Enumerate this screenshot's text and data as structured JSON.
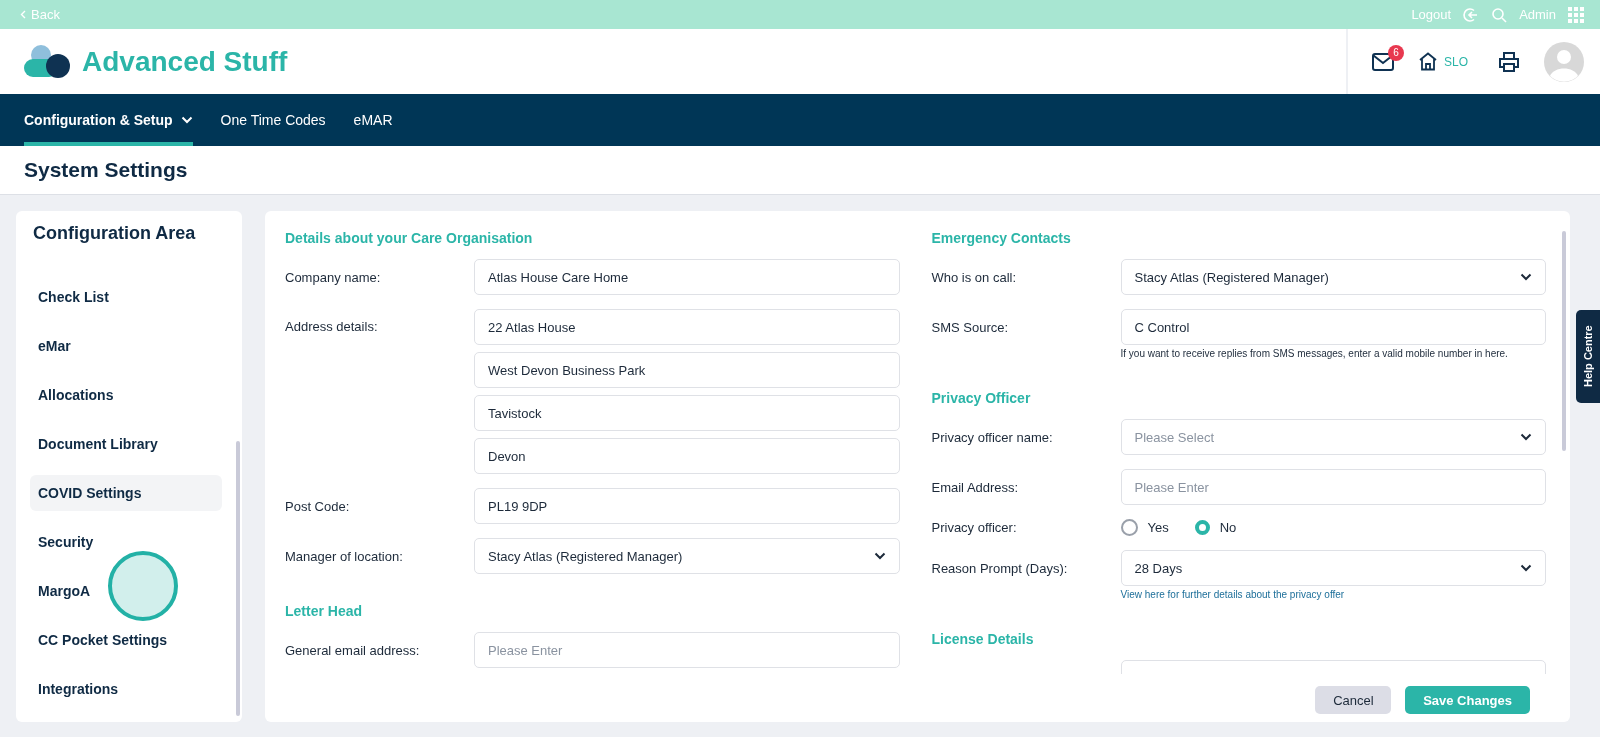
{
  "top_bar": {
    "back": "Back",
    "logout": "Logout",
    "user": "Admin"
  },
  "header": {
    "brand": "Advanced Stuff",
    "mail_badge": "6",
    "home_label": "SLO"
  },
  "nav": [
    {
      "label": "Configuration & Setup",
      "selected": true,
      "has_menu": true
    },
    {
      "label": "One Time Codes",
      "selected": false,
      "has_menu": false
    },
    {
      "label": "eMAR",
      "selected": false,
      "has_menu": false
    }
  ],
  "page_title": "System Settings",
  "sidebar": {
    "title": "Configuration Area",
    "items": [
      {
        "label": "Check List",
        "selected": false
      },
      {
        "label": "eMar",
        "selected": false
      },
      {
        "label": "Allocations",
        "selected": false
      },
      {
        "label": "Document Library",
        "selected": false
      },
      {
        "label": "COVID Settings",
        "selected": true
      },
      {
        "label": "Security",
        "selected": false
      },
      {
        "label": "MargoA",
        "selected": false
      },
      {
        "label": "CC Pocket Settings",
        "selected": false
      },
      {
        "label": "Integrations",
        "selected": false
      }
    ]
  },
  "form": {
    "left": [
      {
        "kind": "heading",
        "text": "Details about your Care Organisation"
      },
      {
        "kind": "input",
        "label": "Company name:",
        "value": "Atlas House Care Home"
      },
      {
        "kind": "address",
        "label": "Address details:",
        "values": [
          "22 Atlas House",
          "West Devon Business Park",
          "Tavistock",
          "Devon"
        ]
      },
      {
        "kind": "input",
        "label": "Post Code:",
        "value": "PL19 9DP"
      },
      {
        "kind": "select",
        "label": "Manager of location:",
        "value": "Stacy Atlas (Registered Manager)"
      },
      {
        "kind": "heading",
        "text": "Letter Head"
      },
      {
        "kind": "input",
        "label": "General email address:",
        "placeholder": "Please Enter"
      }
    ],
    "right": [
      {
        "kind": "heading",
        "text": "Emergency Contacts"
      },
      {
        "kind": "select",
        "label": "Who is on call:",
        "value": "Stacy Atlas (Registered Manager)"
      },
      {
        "kind": "input",
        "label": "SMS Source:",
        "value": "C Control"
      },
      {
        "kind": "hint",
        "text": "If you want to receive replies from SMS messages, enter a valid mobile number in here."
      },
      {
        "kind": "heading",
        "text": "Privacy Officer"
      },
      {
        "kind": "select",
        "label": "Privacy officer name:",
        "placeholder": "Please Select"
      },
      {
        "kind": "input",
        "label": "Email Address:",
        "placeholder": "Please Enter"
      },
      {
        "kind": "radio",
        "label": "Privacy officer:",
        "options": [
          {
            "label": "Yes",
            "selected": false
          },
          {
            "label": "No",
            "selected": true
          }
        ]
      },
      {
        "kind": "select",
        "label": "Reason Prompt (Days):",
        "value": "28 Days"
      },
      {
        "kind": "link",
        "text": "View here for further details about the privacy offer"
      },
      {
        "kind": "heading",
        "text": "License Details"
      },
      {
        "kind": "input"
      }
    ]
  },
  "buttons": {
    "cancel": "Cancel",
    "save": "Save Changes"
  },
  "help_tab": "Help Centre"
}
